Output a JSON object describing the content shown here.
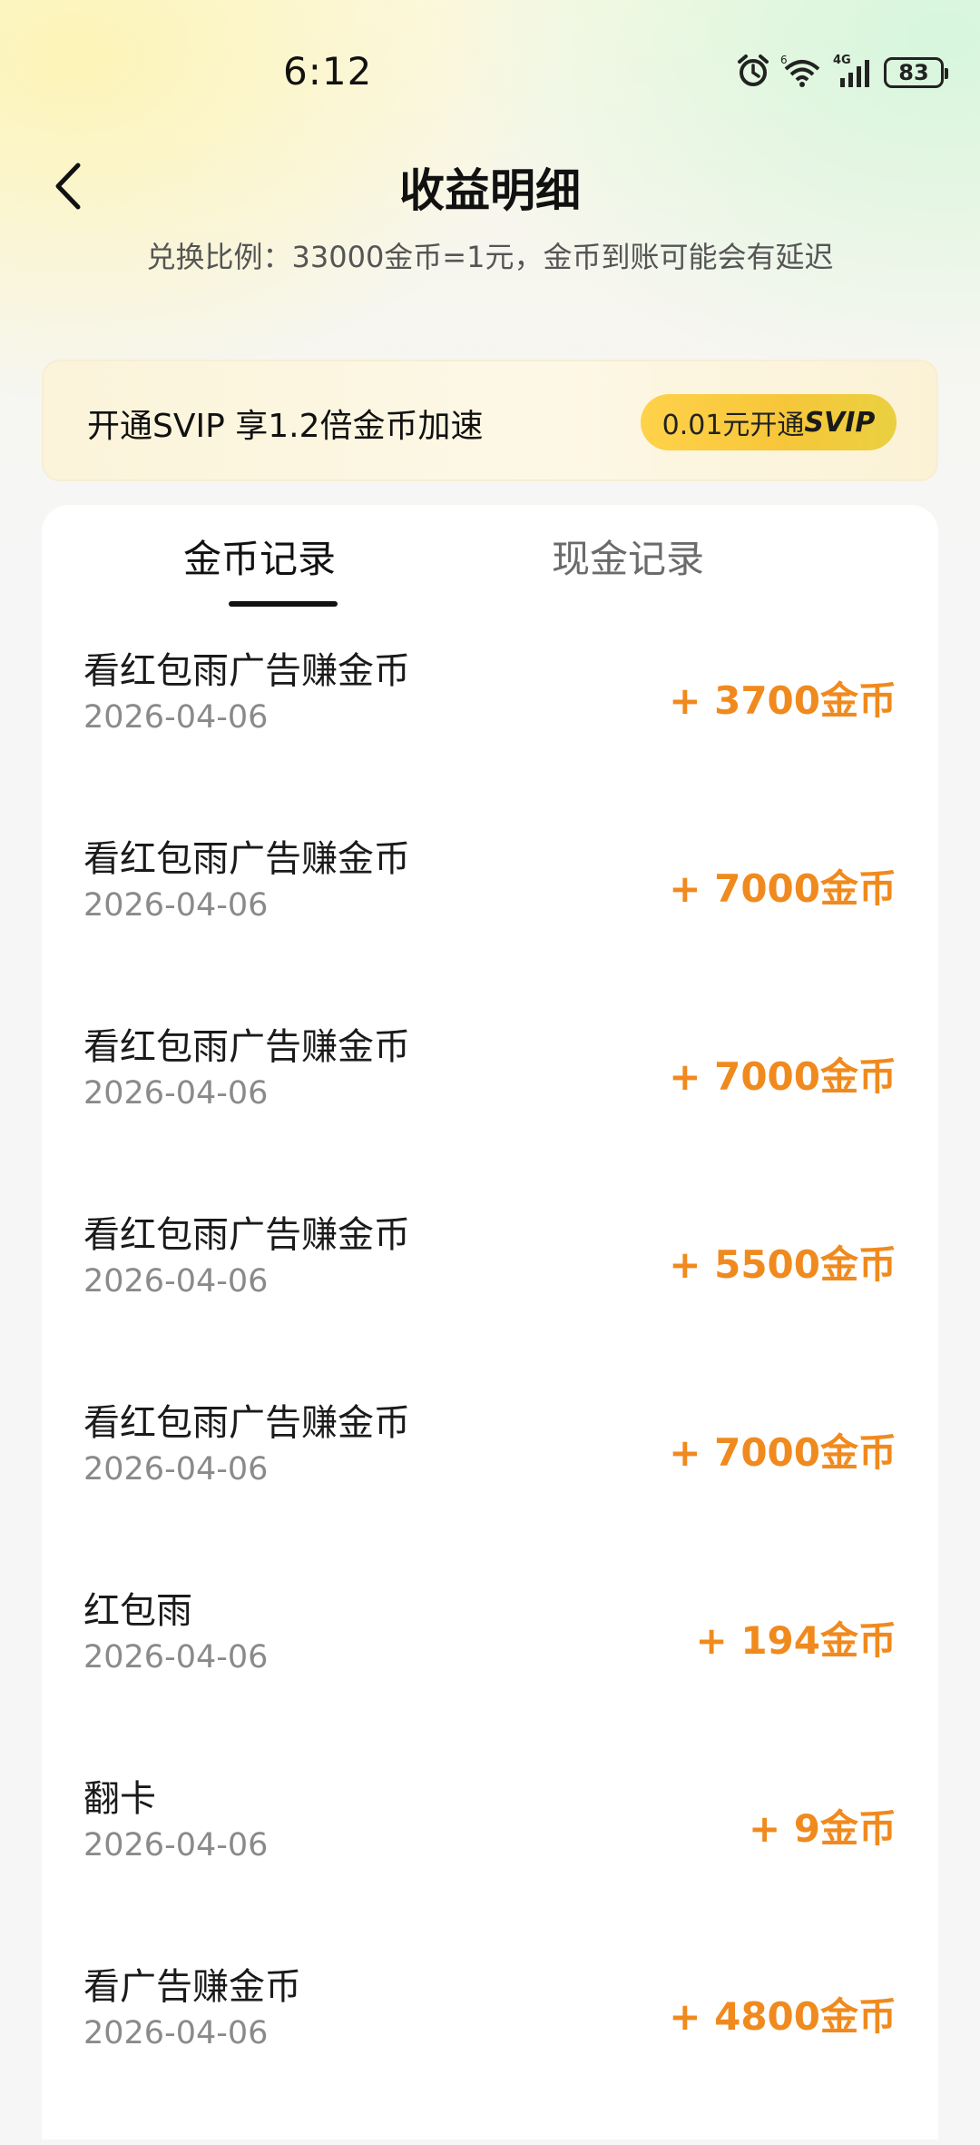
{
  "status_bar": {
    "time": "6:12",
    "network": "4G",
    "battery": "83"
  },
  "header": {
    "title": "收益明细",
    "subtitle": "兑换比例：33000金币=1元，金币到账可能会有延迟"
  },
  "svip": {
    "text": "开通SVIP 享1.2倍金币加速",
    "button_price": "0.01元开通",
    "button_tag": "SVIP"
  },
  "tabs": {
    "coins": "金币记录",
    "cash": "现金记录",
    "active": "coins"
  },
  "records": [
    {
      "title": "看红包雨广告赚金币",
      "date": "2026-04-06",
      "amount": "+ 3700金币"
    },
    {
      "title": "看红包雨广告赚金币",
      "date": "2026-04-06",
      "amount": "+ 7000金币"
    },
    {
      "title": "看红包雨广告赚金币",
      "date": "2026-04-06",
      "amount": "+ 7000金币"
    },
    {
      "title": "看红包雨广告赚金币",
      "date": "2026-04-06",
      "amount": "+ 5500金币"
    },
    {
      "title": "看红包雨广告赚金币",
      "date": "2026-04-06",
      "amount": "+ 7000金币"
    },
    {
      "title": "红包雨",
      "date": "2026-04-06",
      "amount": "+ 194金币"
    },
    {
      "title": "翻卡",
      "date": "2026-04-06",
      "amount": "+ 9金币"
    },
    {
      "title": "看广告赚金币",
      "date": "2026-04-06",
      "amount": "+ 4800金币"
    }
  ],
  "colors": {
    "amount": "#f08a1e",
    "svip_button": "#ffd24a"
  }
}
